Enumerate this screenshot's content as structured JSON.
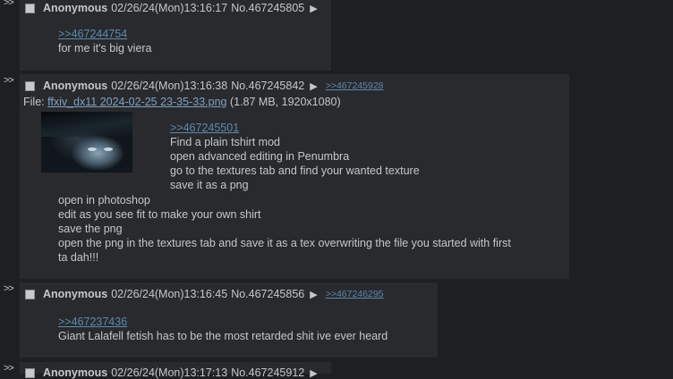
{
  "side_arrows": ">>",
  "menu_glyph": "▶",
  "posts": [
    {
      "name": "Anonymous",
      "datetime": "02/26/24(Mon)13:16:17",
      "number": "No.467245805",
      "quote": ">>467244754",
      "lines": [
        "for me it's big viera"
      ]
    },
    {
      "name": "Anonymous",
      "datetime": "02/26/24(Mon)13:16:38",
      "number": "No.467245842",
      "backlink": ">>467245928",
      "file_label": "File: ",
      "file_name": "ffxiv_dx11 2024-02-25 23-35-33.png",
      "file_info": " (1.87 MB, 1920x1080)",
      "quote": ">>467245501",
      "lines_right": [
        "Find a plain tshirt mod",
        "open advanced editing in Penumbra",
        "go to the textures tab and find your wanted texture",
        "save it as a png"
      ],
      "lines_below": [
        "open in photoshop",
        "edit as you see fit to make your own shirt",
        "save the png",
        "open the png in the textures tab and save it as a tex overwriting the file you started with first",
        "ta dah!!!"
      ]
    },
    {
      "name": "Anonymous",
      "datetime": "02/26/24(Mon)13:16:45",
      "number": "No.467245856",
      "backlink": ">>467246295",
      "quote": ">>467237436",
      "lines": [
        "Giant Lalafell fetish has to be the most retarded shit ive ever heard"
      ]
    },
    {
      "name": "Anonymous",
      "datetime": "02/26/24(Mon)13:17:13",
      "number": "No.467245912"
    }
  ]
}
